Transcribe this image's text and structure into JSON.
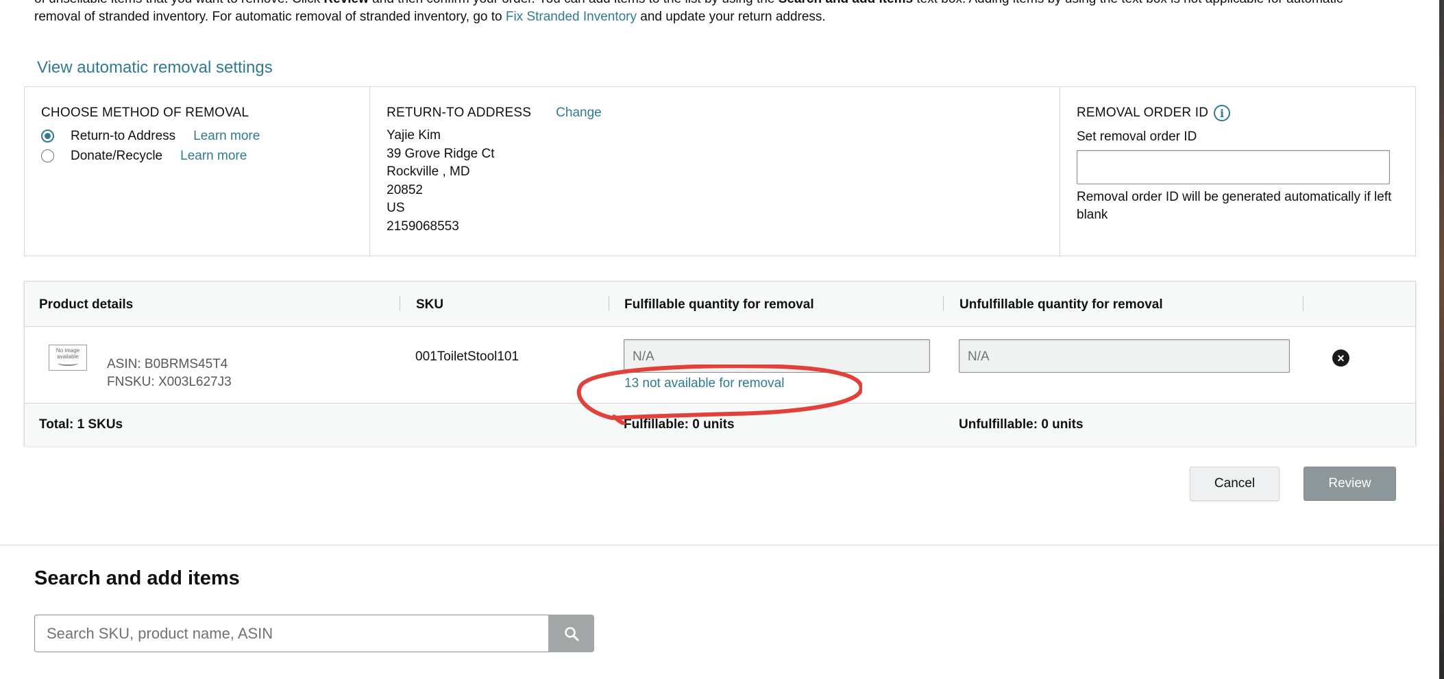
{
  "intro": {
    "line1_prefix": "of unsellable items that you want to remove. Click ",
    "line1_review": "Review",
    "line1_mid": " and then confirm your order. You can add items to the list by using the ",
    "line1_search": "Search and add items",
    "line1_suffix": " text box. Adding items by using the text box is not applicable for automatic",
    "line2_prefix": "removal of stranded inventory. For automatic removal of stranded inventory, go to ",
    "line2_link": "Fix Stranded Inventory",
    "line2_suffix": " and update your return address."
  },
  "auto_settings_link": "View automatic removal settings",
  "method": {
    "title": "CHOOSE METHOD OF REMOVAL",
    "options": [
      {
        "label": "Return-to Address",
        "learn": "Learn more",
        "selected": true
      },
      {
        "label": "Donate/Recycle",
        "learn": "Learn more",
        "selected": false
      }
    ]
  },
  "address": {
    "title": "RETURN-TO ADDRESS",
    "change": "Change",
    "lines": [
      "Yajie Kim",
      "39 Grove Ridge Ct",
      "Rockville , MD",
      "20852",
      "US",
      "2159068553"
    ]
  },
  "order_id": {
    "title": "REMOVAL ORDER ID",
    "info_icon": "info-icon",
    "label": "Set removal order ID",
    "value": "",
    "note": "Removal order ID will be generated automatically if left blank"
  },
  "table": {
    "headers": [
      "Product details",
      "SKU",
      "Fulfillable quantity for removal",
      "Unfulfillable quantity for removal"
    ],
    "rows": [
      {
        "image_text": "No image available",
        "asin": "ASIN: B0BRMS45T4",
        "fnsku": "FNSKU: X003L627J3",
        "sku": "001ToiletStool101",
        "fulfillable_placeholder": "N/A",
        "unfulfillable_placeholder": "N/A",
        "not_available": "13 not available for removal"
      }
    ],
    "footer": {
      "total": "Total: 1 SKUs",
      "fulfillable": "Fulfillable: 0 units",
      "unfulfillable": "Unfulfillable: 0 units"
    }
  },
  "buttons": {
    "cancel": "Cancel",
    "review": "Review"
  },
  "search": {
    "title": "Search and add items",
    "placeholder": "Search SKU, product name, ASIN"
  },
  "colors": {
    "link": "#2f7a91",
    "annotation": "#e0413a",
    "review_disabled": "#8d9699"
  }
}
